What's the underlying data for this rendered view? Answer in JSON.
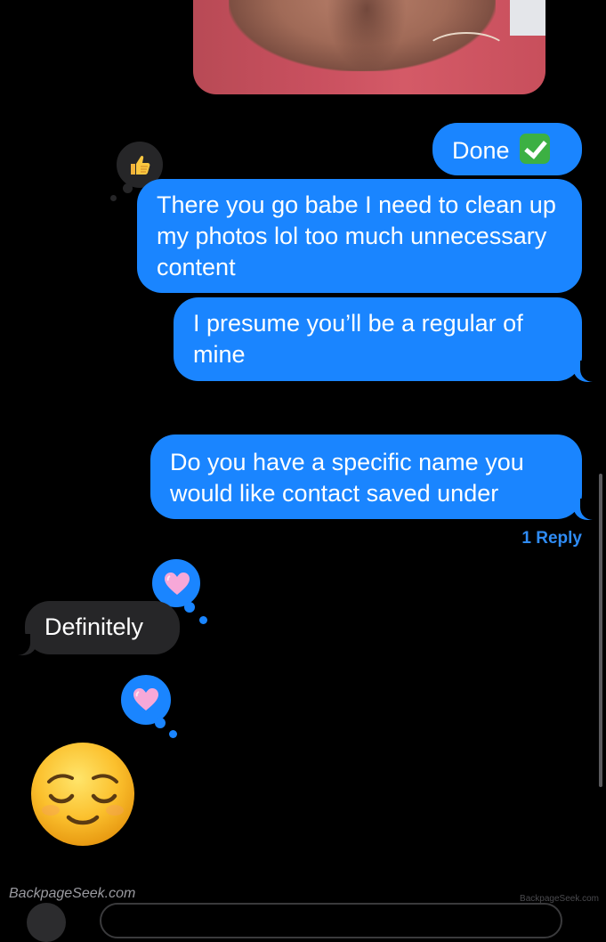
{
  "conversation": {
    "photo_attachment": {
      "icon": "photo-attachment"
    },
    "messages": [
      {
        "direction": "sent",
        "text": "Done",
        "trailing_emoji": "white-heavy-check-mark"
      },
      {
        "direction": "sent",
        "text": "There you go babe I need to clean up my photos lol too much unnecessary content",
        "reaction": "thumbs-up"
      },
      {
        "direction": "sent",
        "text": "I presume you’ll be a regular of mine"
      },
      {
        "direction": "sent",
        "text": "Do you have a specific name you would like contact saved under",
        "reply_count_label": "1 Reply"
      },
      {
        "direction": "received",
        "text": "Definitely",
        "reaction": "pink-heart"
      },
      {
        "direction": "received",
        "emoji_only": "relieved-face",
        "reaction": "pink-heart"
      }
    ]
  },
  "watermark": {
    "left": "BackpageSeek.com",
    "right": "BackpageSeek.com"
  },
  "colors": {
    "sent_bubble": "#1a85ff",
    "received_bubble": "#262628",
    "background": "#000000",
    "reply_link": "#2f8cf5"
  }
}
